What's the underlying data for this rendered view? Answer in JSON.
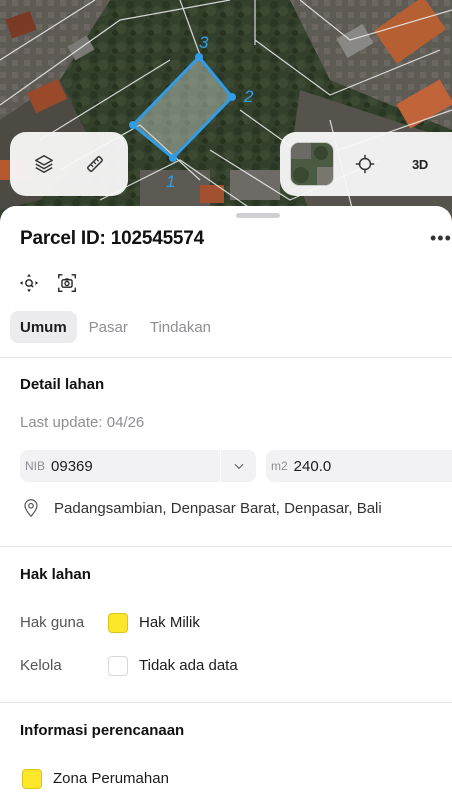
{
  "map": {
    "vertex_labels": [
      "1",
      "2",
      "3"
    ],
    "parcel_color": "#2f9de8",
    "controls": {
      "layers_icon": "layers-icon",
      "ruler_icon": "measure-icon",
      "thumbnail_icon": "satellite-thumbnail",
      "locate_icon": "crosshair-icon",
      "threed_label": "3D"
    }
  },
  "parcel": {
    "title": "Parcel ID: 102545574",
    "more_label": "•••"
  },
  "tabs": [
    {
      "label": "Umum",
      "active": true
    },
    {
      "label": "Pasar",
      "active": false
    },
    {
      "label": "Tindakan",
      "active": false
    }
  ],
  "detail": {
    "title": "Detail lahan",
    "last_update": "Last update: 04/26",
    "nib_prefix": "NIB",
    "nib_value": "09369",
    "area_prefix": "m2",
    "area_value": "240.0",
    "address": "Padangsambian, Denpasar Barat, Denpasar, Bali"
  },
  "hak": {
    "title": "Hak lahan",
    "rows": [
      {
        "label": "Hak guna",
        "value": "Hak Milik",
        "swatch": "#fce72a"
      },
      {
        "label": "Kelola",
        "value": "Tidak ada data",
        "swatch": "#ffffff"
      }
    ]
  },
  "planning": {
    "title": "Informasi perencanaan",
    "zone": "Zona Perumahan",
    "zone_color": "#fce72a"
  }
}
